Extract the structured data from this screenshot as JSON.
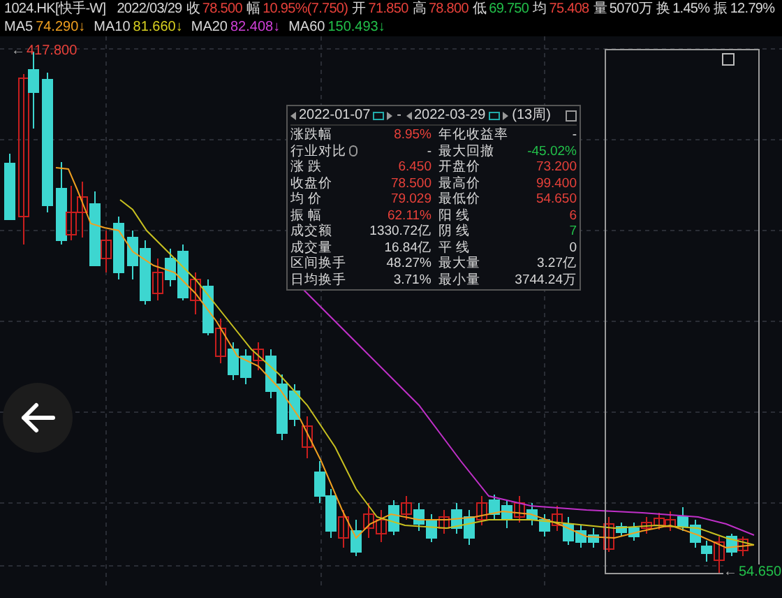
{
  "quote_bar": {
    "symbol": "1024.HK[快手-W]",
    "date": "2022/03/29",
    "stats": [
      {
        "label": "收",
        "value": "78.500",
        "color": "#e8413a"
      },
      {
        "label": "幅",
        "value": "10.95%(7.750)",
        "color": "#e8413a"
      },
      {
        "label": "开",
        "value": "71.850",
        "color": "#e8413a"
      },
      {
        "label": "高",
        "value": "78.800",
        "color": "#e8413a"
      },
      {
        "label": "低",
        "value": "69.750",
        "color": "#22c04a"
      },
      {
        "label": "均",
        "value": "75.408",
        "color": "#e8413a"
      },
      {
        "label": "量",
        "value": "5070万",
        "color": "#d8d8d8"
      },
      {
        "label": "换",
        "value": "1.45%",
        "color": "#d8d8d8"
      },
      {
        "label": "振",
        "value": "12.79%",
        "color": "#d8d8d8"
      }
    ]
  },
  "ma_bar": [
    {
      "label": "MA5",
      "value": "74.290",
      "arrow": "↓",
      "color": "#f0a020"
    },
    {
      "label": "MA10",
      "value": "81.660",
      "arrow": "↓",
      "color": "#d8d020"
    },
    {
      "label": "MA20",
      "value": "82.408",
      "arrow": "↓",
      "color": "#d040d8"
    },
    {
      "label": "MA60",
      "value": "150.493",
      "arrow": "↓",
      "color": "#22c04a"
    }
  ],
  "price_marks": {
    "high": {
      "arrow": "←",
      "value": "417.800"
    },
    "low": {
      "arrow": "←",
      "value": "54.650"
    }
  },
  "interval_panel": {
    "start_date": "2022-01-07",
    "end_date": "2022-03-29",
    "separator": "-",
    "period": "(13周)",
    "rows": [
      {
        "left": {
          "label": "涨跌幅",
          "value": "8.95%",
          "color": "#e8413a"
        },
        "right": {
          "label": "年化收益率",
          "value": "-"
        }
      },
      {
        "left": {
          "label": "行业对比",
          "help": true,
          "value": "-"
        },
        "right": {
          "label": "最大回撤",
          "value": "-45.02%",
          "color": "#22c04a"
        }
      },
      {
        "left": {
          "label": "涨 跌",
          "value": "6.450",
          "color": "#e8413a"
        },
        "right": {
          "label": "开盘价",
          "value": "73.200",
          "color": "#e8413a"
        }
      },
      {
        "left": {
          "label": "收盘价",
          "value": "78.500",
          "color": "#e8413a"
        },
        "right": {
          "label": "最高价",
          "value": "99.400",
          "color": "#e8413a"
        }
      },
      {
        "left": {
          "label": "均 价",
          "value": "79.029",
          "color": "#e8413a"
        },
        "right": {
          "label": "最低价",
          "value": "54.650",
          "color": "#e8413a"
        }
      },
      {
        "left": {
          "label": "振 幅",
          "value": "62.11%",
          "color": "#e8413a"
        },
        "right": {
          "label": "阳 线",
          "value": "6",
          "color": "#e8413a"
        }
      },
      {
        "left": {
          "label": "成交额",
          "value": "1330.72亿",
          "color": "#d8d8d8"
        },
        "right": {
          "label": "阴 线",
          "value": "7",
          "color": "#22c04a"
        }
      },
      {
        "left": {
          "label": "成交量",
          "value": "16.84亿",
          "color": "#d8d8d8"
        },
        "right": {
          "label": "平 线",
          "value": "0",
          "color": "#d8d8d8"
        }
      },
      {
        "left": {
          "label": "区间换手",
          "value": "48.27%",
          "color": "#d8d8d8"
        },
        "right": {
          "label": "最大量",
          "value": "3.27亿",
          "color": "#d8d8d8"
        }
      },
      {
        "left": {
          "label": "日均换手",
          "value": "3.71%",
          "color": "#d8d8d8"
        },
        "right": {
          "label": "最小量",
          "value": "3744.24万",
          "color": "#d8d8d8"
        }
      }
    ]
  }
}
